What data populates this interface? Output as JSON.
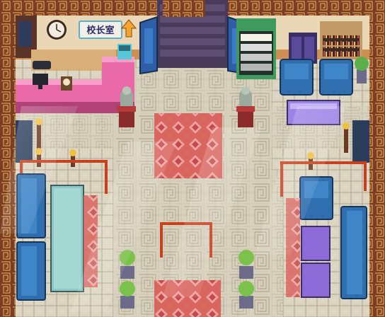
{
  "scene": {
    "sign": {
      "text": "校长室",
      "arrow": "up-arrow"
    },
    "colors": {
      "floor": "#ddd6c2",
      "floor_line": "#bdb39b",
      "wall": "#8a4a2a",
      "wall_trim": "#d9a055",
      "counter": "#e968a8",
      "sofa": "#2f6fb0",
      "rug": "#d9655f",
      "rail": "#c8401e",
      "purple_bench": "#8c6ad8"
    }
  }
}
